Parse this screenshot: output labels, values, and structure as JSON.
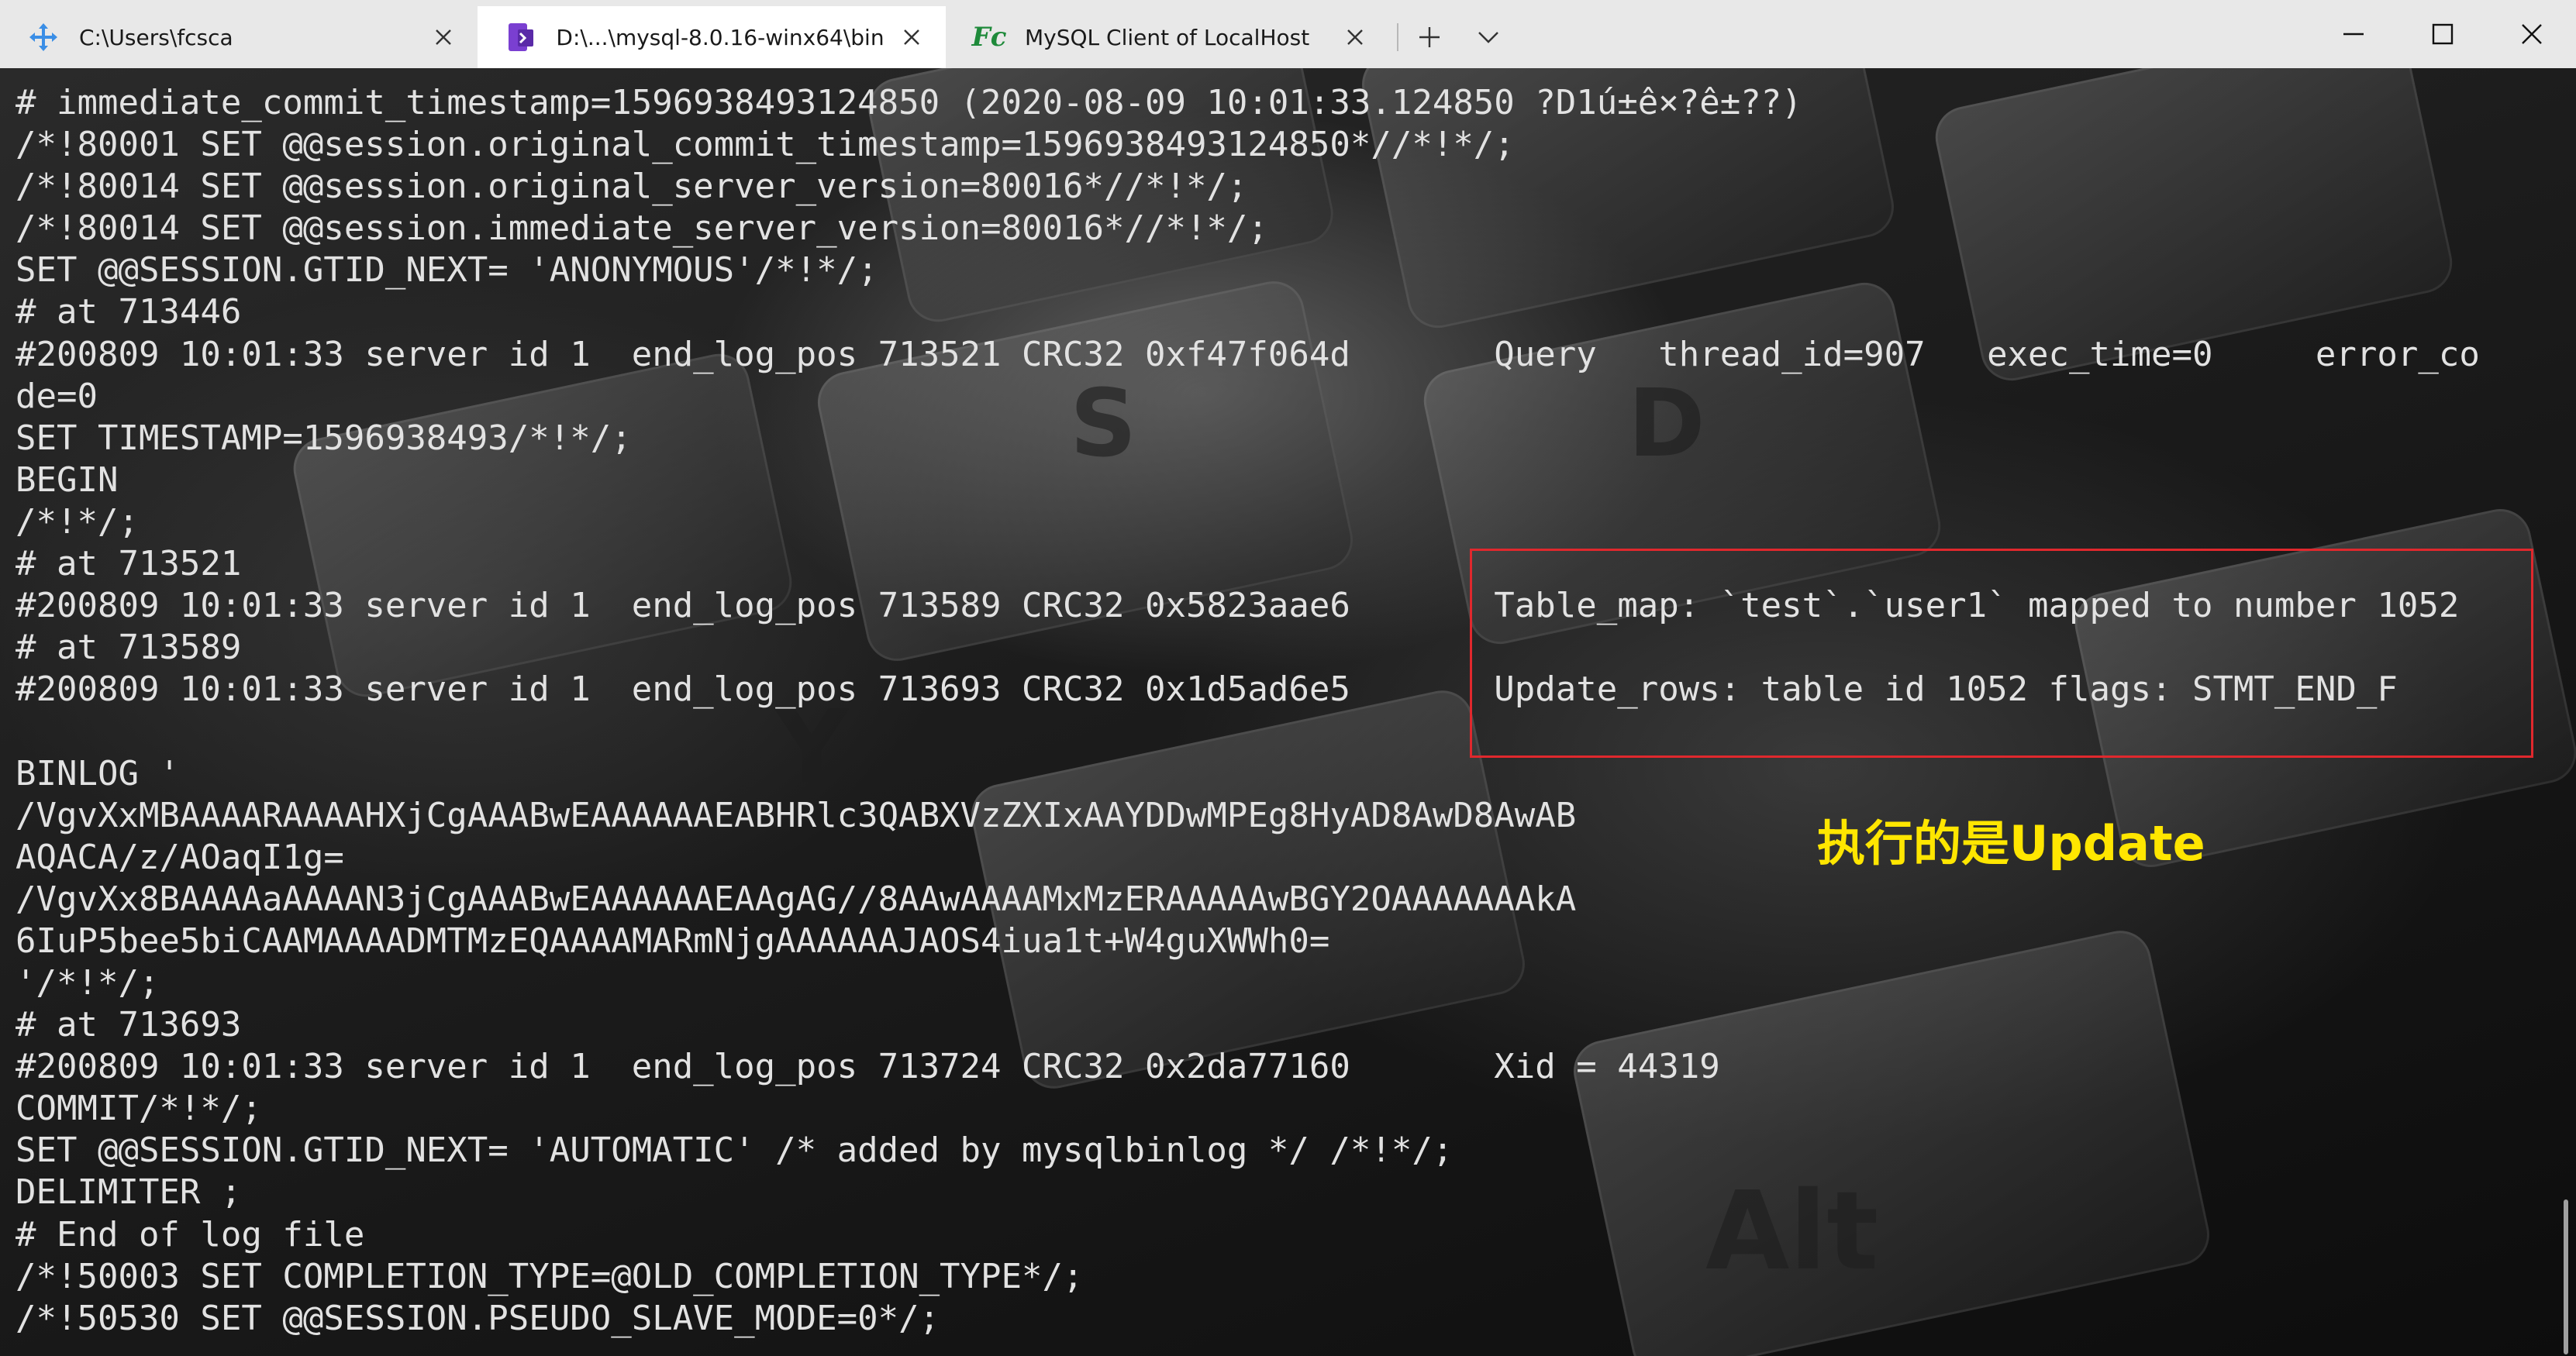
{
  "tabs": [
    {
      "label": "C:\\Users\\fcsca",
      "icon": "network-icon",
      "active": false
    },
    {
      "label": "D:\\...\\mysql-8.0.16-winx64\\bin",
      "icon": "powershell-icon",
      "active": true
    },
    {
      "label": "MySQL Client of LocalHost",
      "icon": "fc-app-icon",
      "icon_text": "Fc",
      "active": false
    }
  ],
  "tab_actions": {
    "new_tab": "+",
    "dropdown": "chevron-down-icon"
  },
  "window_controls": [
    "minimize-icon",
    "maximize-icon",
    "close-icon"
  ],
  "terminal": {
    "lines": [
      "# immediate_commit_timestamp=1596938493124850 (2020-08-09 10:01:33.124850 ?D1ú±ê×?ê±??)",
      "/*!80001 SET @@session.original_commit_timestamp=1596938493124850*//*!*/;",
      "/*!80014 SET @@session.original_server_version=80016*//*!*/;",
      "/*!80014 SET @@session.immediate_server_version=80016*//*!*/;",
      "SET @@SESSION.GTID_NEXT= 'ANONYMOUS'/*!*/;",
      "# at 713446",
      "#200809 10:01:33 server id 1  end_log_pos 713521 CRC32 0xf47f064d       Query   thread_id=907   exec_time=0     error_co",
      "de=0",
      "SET TIMESTAMP=1596938493/*!*/;",
      "BEGIN",
      "/*!*/;",
      "# at 713521",
      "#200809 10:01:33 server id 1  end_log_pos 713589 CRC32 0x5823aae6       Table_map: `test`.`user1` mapped to number 1052",
      "# at 713589",
      "#200809 10:01:33 server id 1  end_log_pos 713693 CRC32 0x1d5ad6e5       Update_rows: table id 1052 flags: STMT_END_F",
      "",
      "BINLOG '",
      "/VgvXxMBAAAARAAAAHXjCgAAABwEAAAAAAEABHRlc3QABXVzZXIxAAYDDwMPEg8HyAD8AwD8AwAB",
      "AQACA/z/AOaqI1g=",
      "/VgvXx8BAAAAaAAAAN3jCgAAABwEAAAAAAEAAgAG//8AAwAAAAMxMzERAAAAAwBGY2OAAAAAAAkA",
      "6IuP5bee5biCAAMAAAADMTMzEQAAAAMARmNjgAAAAAAJAOS4iua1t+W4guXWWh0=",
      "'/*!*/;",
      "# at 713693",
      "#200809 10:01:33 server id 1  end_log_pos 713724 CRC32 0x2da77160       Xid = 44319",
      "COMMIT/*!*/;",
      "SET @@SESSION.GTID_NEXT= 'AUTOMATIC' /* added by mysqlbinlog */ /*!*/;",
      "DELIMITER ;",
      "# End of log file",
      "/*!50003 SET COMPLETION_TYPE=@OLD_COMPLETION_TYPE*/;",
      "/*!50530 SET @@SESSION.PSEUDO_SLAVE_MODE=0*/;"
    ],
    "annotation": "执行的是Update",
    "colors": {
      "text": "#e2e2e2",
      "highlight_border": "#e0282d",
      "annotation": "#ffe600"
    }
  }
}
